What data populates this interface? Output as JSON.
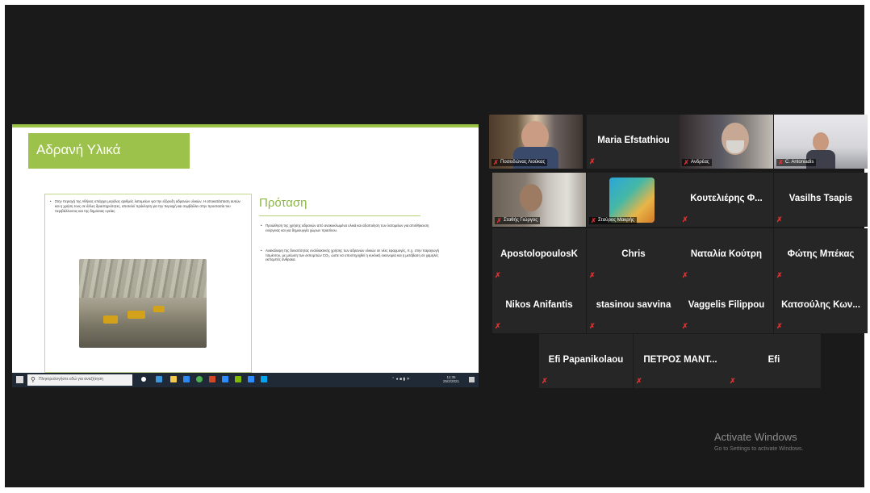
{
  "slide": {
    "title": "Αδρανή Υλικά",
    "left_text": "Στην περιοχή της Αθήνας υπάρχει μεγάλος αριθμός λατομείων για την εξόρυξη αδρανών υλικών. Η αποκατάσταση αυτών και η χρήση τους σε άλλες δραστηριότητες, αποτελεί πρόκληση για την περιοχή και συμβάλλει στην προστασία του περιβάλλοντος και της δημόσιας υγείας.",
    "proposal_title": "Πρόταση",
    "proposal_bullet_1": "Προώθηση της χρήσης αδρανών από ανακυκλωμένα υλικά και αξιοποίηση των λατομείων για αποθήκευση ενέργειας και για δημιουργία χώρων πρασίνου.",
    "proposal_bullet_2": "Ανακάλυψη της δυνατότητας εναλλακτικής χρήσης των αδρανών υλικών σε νέες εφαρμογές, π.χ. στην παραγωγή τσιμέντου, με μείωση των εκπομπών CO₂, ώστε να υποστηριχθεί η κυκλική οικονομία και η μετάβαση σε χαμηλές εκπομπές άνθρακα."
  },
  "taskbar": {
    "search_placeholder": "Πληκτρολογήστε εδώ για αναζήτηση",
    "time": "11:35",
    "date": "25/2/2021"
  },
  "participants": [
    {
      "name": "Ποσειδώνας Λιούκας",
      "type": "video",
      "active": true
    },
    {
      "name": "Maria Efstathiou",
      "type": "name"
    },
    {
      "name": "Ανδρέας",
      "type": "video"
    },
    {
      "name": "C. Antoniadis",
      "type": "video"
    },
    {
      "name": "Σταθής Γιώργος",
      "type": "video"
    },
    {
      "name": "Σταύρος Μακρής",
      "type": "video"
    },
    {
      "name": "Κουτελιέρης Φ...",
      "type": "name"
    },
    {
      "name": "Vasilhs Tsapis",
      "type": "name"
    },
    {
      "name": "ApostolopoulosK",
      "type": "name"
    },
    {
      "name": "Chris",
      "type": "name"
    },
    {
      "name": "Ναταλία Κούτρη",
      "type": "name"
    },
    {
      "name": "Φώτης Μπέκας",
      "type": "name"
    },
    {
      "name": "Nikos Anifantis",
      "type": "name"
    },
    {
      "name": "stasinou savvina",
      "type": "name"
    },
    {
      "name": "Vaggelis Filippou",
      "type": "name"
    },
    {
      "name": "Κατσούλης Κων...",
      "type": "name"
    },
    {
      "name": "Efi Papanikolaou",
      "type": "name"
    },
    {
      "name": "ΠΕΤΡΟΣ ΜΑΝΤ...",
      "type": "name"
    },
    {
      "name": "Efi",
      "type": "name"
    }
  ],
  "watermark": {
    "title": "Activate Windows",
    "subtitle": "Go to Settings to activate Windows."
  },
  "icons": {
    "mute": "mic-muted-icon"
  },
  "colors": {
    "accent": "#9cc24b",
    "active_border": "#c7da3a",
    "mute": "#e03232",
    "tile_bg": "#262626"
  }
}
